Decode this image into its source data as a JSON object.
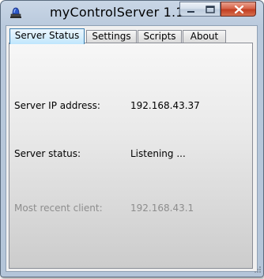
{
  "window": {
    "title": "myControlServer 1.1",
    "icon": "blue-alarm-beacon-icon"
  },
  "tabs": [
    {
      "label": "Server Status",
      "active": true
    },
    {
      "label": "Settings",
      "active": false
    },
    {
      "label": "Scripts",
      "active": false
    },
    {
      "label": "About",
      "active": false
    }
  ],
  "status": {
    "ip_label": "Server IP address:",
    "ip_value": "192.168.43.37",
    "state_label": "Server status:",
    "state_value": "Listening ...",
    "client_label": "Most recent client:",
    "client_value": "192.168.43.1"
  },
  "colors": {
    "accent": "#3c7fb1",
    "close_button": "#c23e21",
    "disabled_text": "#8d8d8d"
  }
}
